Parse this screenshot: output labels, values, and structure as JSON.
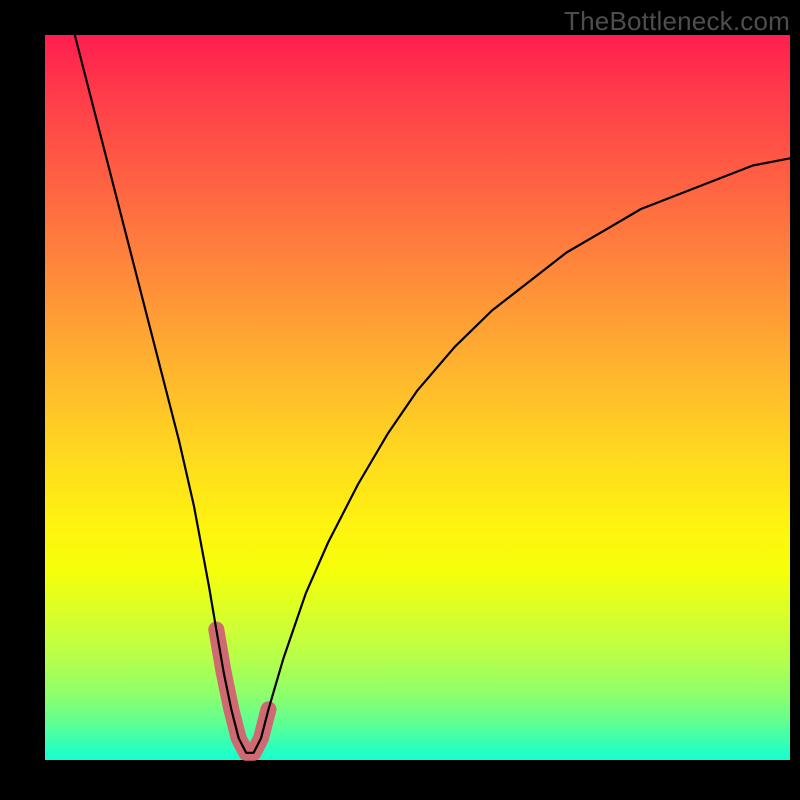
{
  "watermark": "TheBottleneck.com",
  "chart_data": {
    "type": "line",
    "title": "",
    "xlabel": "",
    "ylabel": "",
    "xlim": [
      0,
      100
    ],
    "ylim": [
      0,
      100
    ],
    "grid": false,
    "legend": false,
    "series": [
      {
        "name": "bottleneck-curve",
        "x": [
          4,
          6,
          8,
          10,
          12,
          14,
          16,
          18,
          20,
          22,
          23,
          24,
          25,
          26,
          27,
          28,
          29,
          30,
          32,
          35,
          38,
          42,
          46,
          50,
          55,
          60,
          65,
          70,
          75,
          80,
          85,
          90,
          95,
          100
        ],
        "values": [
          100,
          92,
          84,
          76,
          68,
          60,
          52,
          44,
          35,
          24,
          18,
          12,
          7,
          3,
          1,
          1,
          3,
          7,
          14,
          23,
          30,
          38,
          45,
          51,
          57,
          62,
          66,
          70,
          73,
          76,
          78,
          80,
          82,
          83
        ]
      }
    ],
    "highlight_region": {
      "series": "bottleneck-curve",
      "x_start": 22.5,
      "x_end": 31,
      "color": "#cf6a72"
    },
    "colors": {
      "gradient_top": "#ff1e50",
      "gradient_bottom": "#17ffd0",
      "curve": "#000000",
      "highlight": "#cf6a72",
      "frame": "#000000"
    }
  }
}
